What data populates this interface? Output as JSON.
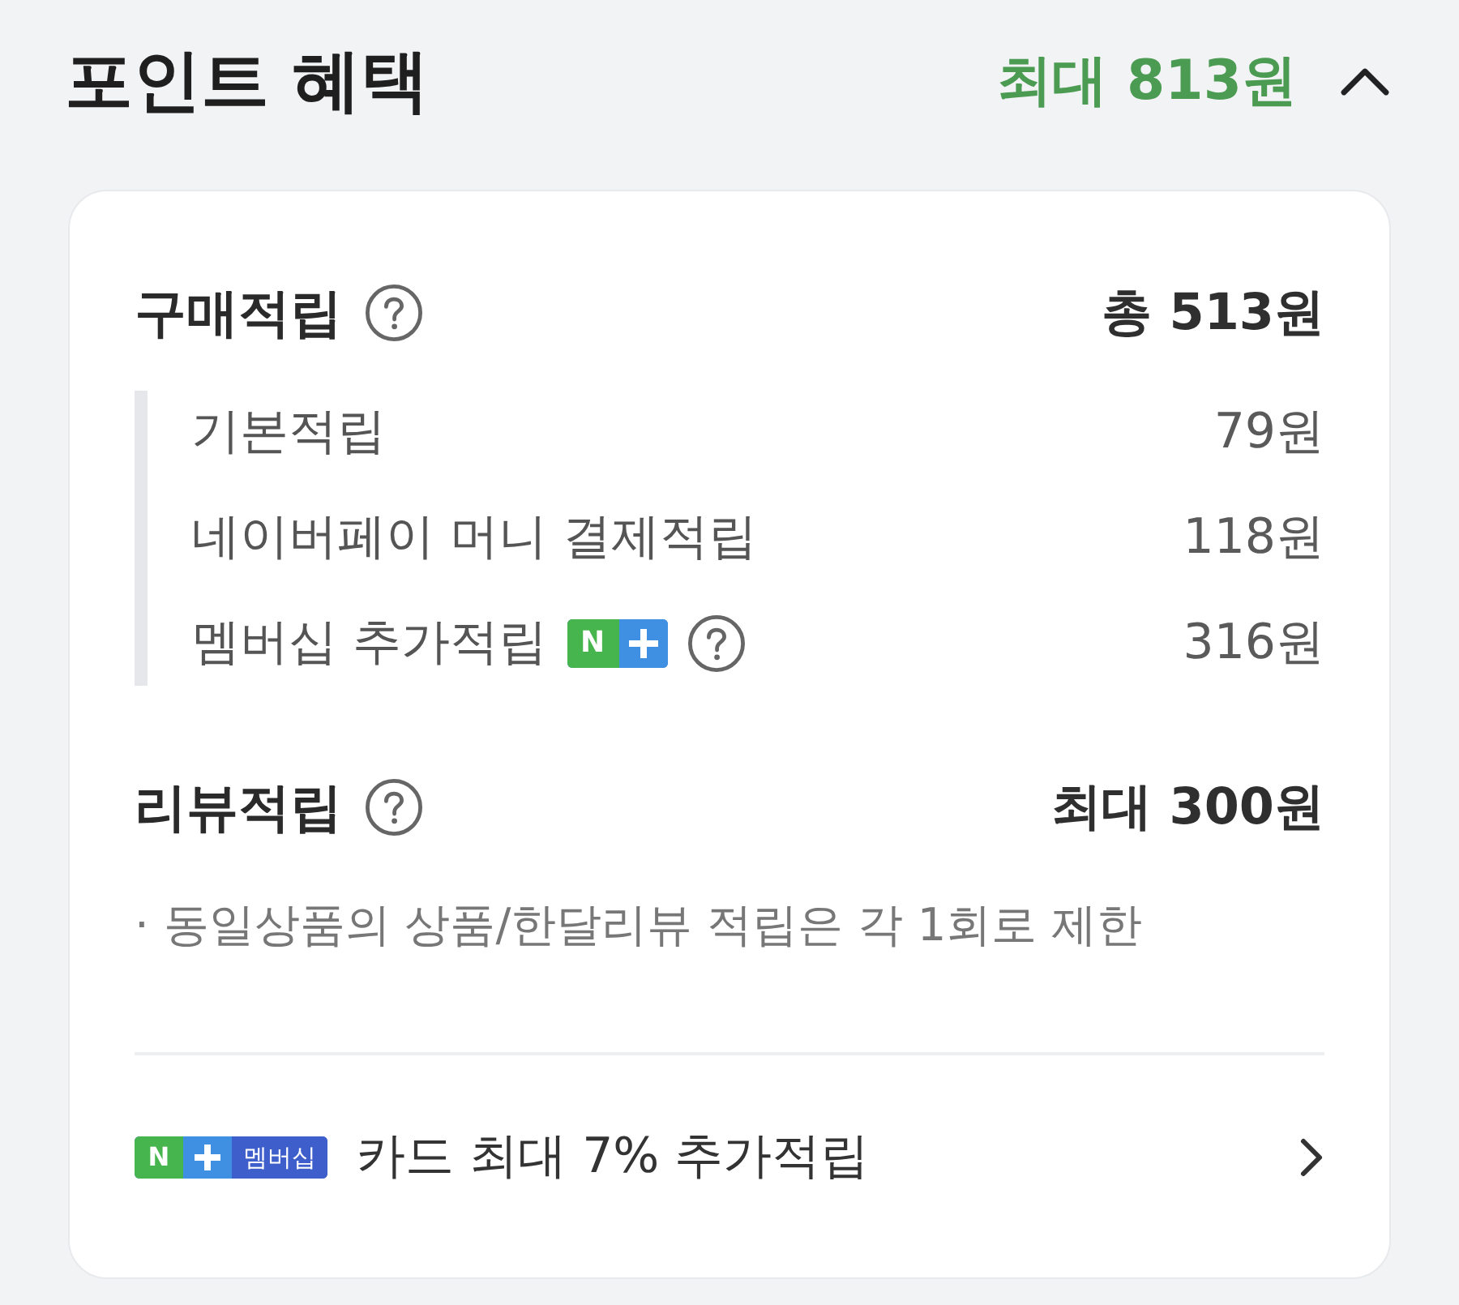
{
  "header": {
    "title": "포인트 혜택",
    "summary": "최대 813원",
    "expanded": true
  },
  "sections": [
    {
      "title": "구매적립",
      "total": "총 513원",
      "help": true,
      "items": [
        {
          "label": "기본적립",
          "amount": "79원"
        },
        {
          "label": "네이버페이 머니 결제적립",
          "amount": "118원"
        },
        {
          "label": "멤버십 추가적립",
          "amount": "316원",
          "badge": {
            "letter": "N"
          },
          "help": true
        }
      ]
    },
    {
      "title": "리뷰적립",
      "total": "최대 300원",
      "help": true,
      "notes": [
        "· 동일상품의 상품/한달리뷰 적립은 각 1회로 제한"
      ]
    }
  ],
  "card_promo": {
    "badge": {
      "letter": "N",
      "label": "멤버십"
    },
    "text": "카드 최대 7% 추가적립"
  }
}
